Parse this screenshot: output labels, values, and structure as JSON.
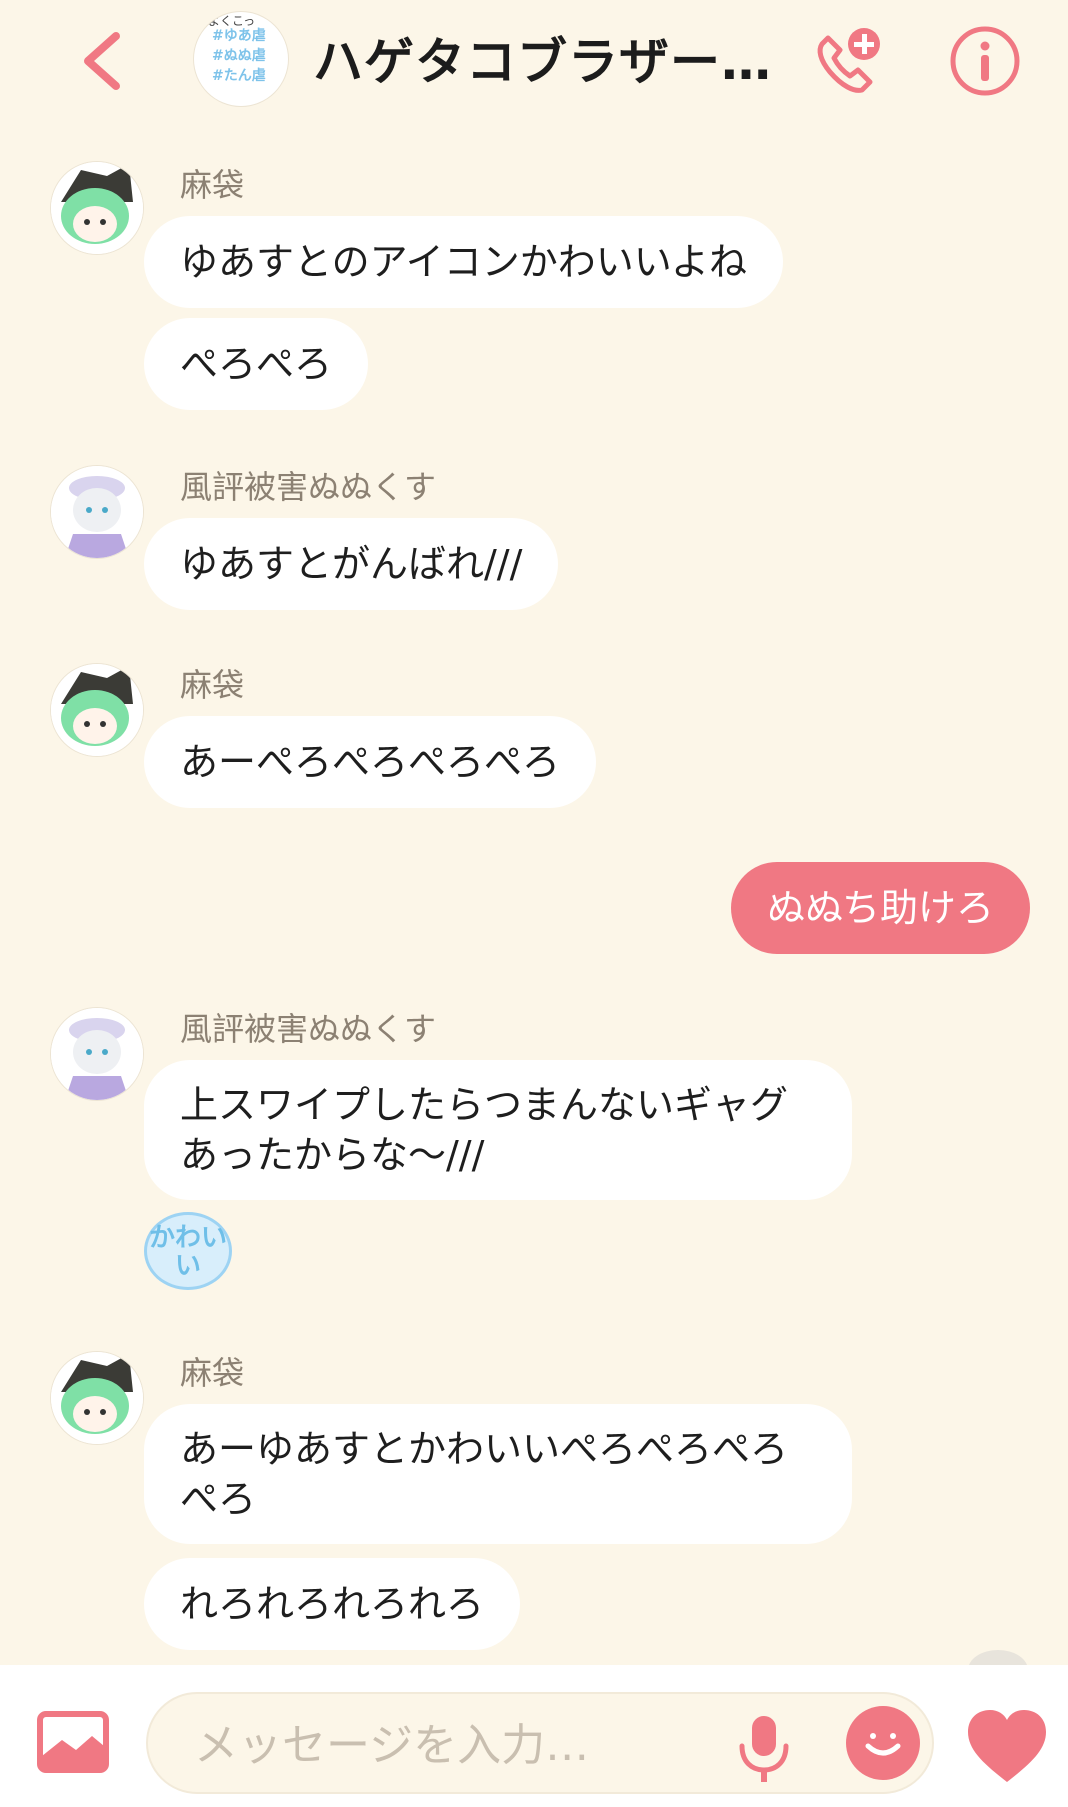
{
  "colors": {
    "background": "#fcf6e8",
    "accent": "#f07883",
    "bubble_other": "#ffffff",
    "bubble_mine": "#f07883",
    "sender_name": "#8c8173"
  },
  "header": {
    "title": "ハゲタコブラザー…",
    "group_avatar_tags": [
      "#ゆあ虐",
      "#ぬぬ虐",
      "#たん虐"
    ],
    "group_avatar_top": "よくこっ",
    "icons": [
      "chevron-left-icon",
      "call-plus-icon",
      "info-icon"
    ]
  },
  "messages": [
    {
      "sender": "麻袋",
      "bubbles": [
        "ゆあすとのアイコンかわいいよね",
        "ぺろぺろ"
      ]
    },
    {
      "sender": "風評被害ぬぬくす",
      "bubbles": [
        "ゆあすとがんばれ///"
      ]
    },
    {
      "sender": "麻袋",
      "bubbles": [
        "あーぺろぺろぺろぺろ"
      ]
    },
    {
      "sender": "me",
      "bubbles": [
        "ぬぬち助けろ"
      ]
    },
    {
      "sender": "風評被害ぬぬくす",
      "bubbles": [
        "上スワイプしたらつまんないギャグあったからな〜///"
      ],
      "reaction": "かわいい"
    },
    {
      "sender": "麻袋",
      "bubbles": [
        "あーゆあすとかわいいぺろぺろぺろぺろ",
        "れろれろれろれろ"
      ]
    }
  ],
  "input_bar": {
    "placeholder": "メッセージを入力…",
    "icons": [
      "image-icon",
      "microphone-icon",
      "smiley-icon",
      "heart-icon"
    ]
  }
}
